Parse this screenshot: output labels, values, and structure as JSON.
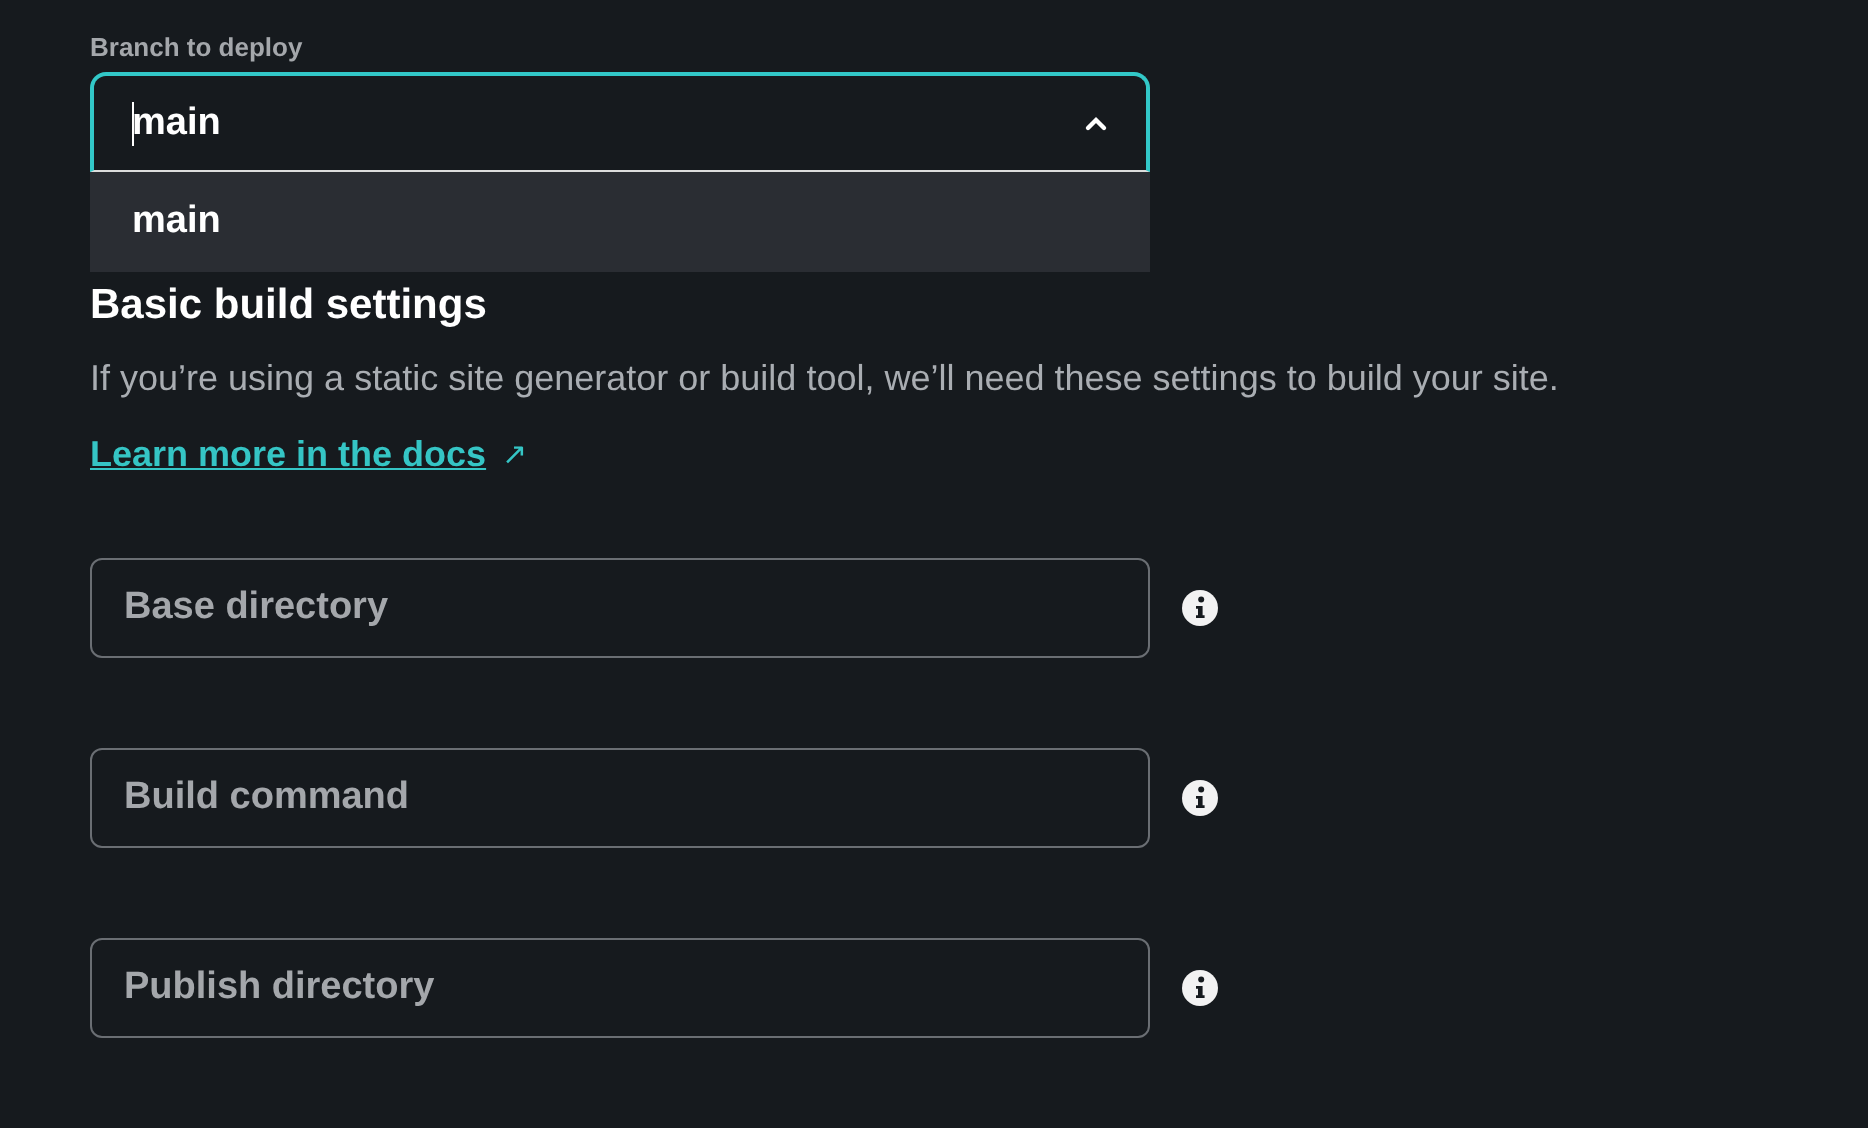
{
  "branch_select": {
    "label": "Branch to deploy",
    "value": "main",
    "expanded": true,
    "options": [
      "main"
    ]
  },
  "section": {
    "title": "Basic build settings",
    "description": "If you’re using a static site generator or build tool, we’ll need these settings to build your site.",
    "link": "Learn more in the docs",
    "link_icon": "↗"
  },
  "fields": [
    {
      "placeholder": "Base directory"
    },
    {
      "placeholder": "Build command"
    },
    {
      "placeholder": "Publish directory"
    }
  ]
}
